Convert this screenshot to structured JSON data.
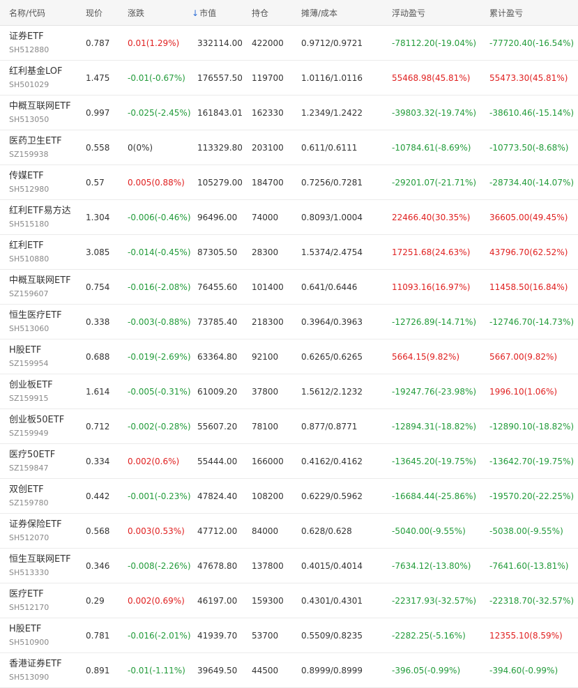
{
  "headers": {
    "name": "名称/代码",
    "price": "现价",
    "change": "涨跌",
    "market_value": "市值",
    "position": "持仓",
    "cost": "摊薄/成本",
    "float_pl": "浮动盈亏",
    "total_pl": "累计盈亏"
  },
  "sort": {
    "column": "market_value",
    "direction": "desc",
    "icon": "arrow-down-icon"
  },
  "colors": {
    "up": "#e02020",
    "down": "#229b3a",
    "flat": "#333333",
    "sort": "#2f6fd6"
  },
  "rows": [
    {
      "name": "证券ETF",
      "code": "SH512880",
      "price": "0.787",
      "change": "0.01(1.29%)",
      "change_dir": "up",
      "market_value": "332114.00",
      "position": "422000",
      "cost": "0.9712/0.9721",
      "float_pl": "-78112.20(-19.04%)",
      "float_dir": "down",
      "total_pl": "-77720.40(-16.54%)",
      "total_dir": "down"
    },
    {
      "name": "红利基金LOF",
      "code": "SH501029",
      "price": "1.475",
      "change": "-0.01(-0.67%)",
      "change_dir": "down",
      "market_value": "176557.50",
      "position": "119700",
      "cost": "1.0116/1.0116",
      "float_pl": "55468.98(45.81%)",
      "float_dir": "up",
      "total_pl": "55473.30(45.81%)",
      "total_dir": "up"
    },
    {
      "name": "中概互联网ETF",
      "code": "SH513050",
      "price": "0.997",
      "change": "-0.025(-2.45%)",
      "change_dir": "down",
      "market_value": "161843.01",
      "position": "162330",
      "cost": "1.2349/1.2422",
      "float_pl": "-39803.32(-19.74%)",
      "float_dir": "down",
      "total_pl": "-38610.46(-15.14%)",
      "total_dir": "down"
    },
    {
      "name": "医药卫生ETF",
      "code": "SZ159938",
      "price": "0.558",
      "change": "0(0%)",
      "change_dir": "flat",
      "market_value": "113329.80",
      "position": "203100",
      "cost": "0.611/0.6111",
      "float_pl": "-10784.61(-8.69%)",
      "float_dir": "down",
      "total_pl": "-10773.50(-8.68%)",
      "total_dir": "down"
    },
    {
      "name": "传媒ETF",
      "code": "SH512980",
      "price": "0.57",
      "change": "0.005(0.88%)",
      "change_dir": "up",
      "market_value": "105279.00",
      "position": "184700",
      "cost": "0.7256/0.7281",
      "float_pl": "-29201.07(-21.71%)",
      "float_dir": "down",
      "total_pl": "-28734.40(-14.07%)",
      "total_dir": "down"
    },
    {
      "name": "红利ETF易方达",
      "code": "SH515180",
      "price": "1.304",
      "change": "-0.006(-0.46%)",
      "change_dir": "down",
      "market_value": "96496.00",
      "position": "74000",
      "cost": "0.8093/1.0004",
      "float_pl": "22466.40(30.35%)",
      "float_dir": "up",
      "total_pl": "36605.00(49.45%)",
      "total_dir": "up"
    },
    {
      "name": "红利ETF",
      "code": "SH510880",
      "price": "3.085",
      "change": "-0.014(-0.45%)",
      "change_dir": "down",
      "market_value": "87305.50",
      "position": "28300",
      "cost": "1.5374/2.4754",
      "float_pl": "17251.68(24.63%)",
      "float_dir": "up",
      "total_pl": "43796.70(62.52%)",
      "total_dir": "up"
    },
    {
      "name": "中概互联网ETF",
      "code": "SZ159607",
      "price": "0.754",
      "change": "-0.016(-2.08%)",
      "change_dir": "down",
      "market_value": "76455.60",
      "position": "101400",
      "cost": "0.641/0.6446",
      "float_pl": "11093.16(16.97%)",
      "float_dir": "up",
      "total_pl": "11458.50(16.84%)",
      "total_dir": "up"
    },
    {
      "name": "恒生医疗ETF",
      "code": "SH513060",
      "price": "0.338",
      "change": "-0.003(-0.88%)",
      "change_dir": "down",
      "market_value": "73785.40",
      "position": "218300",
      "cost": "0.3964/0.3963",
      "float_pl": "-12726.89(-14.71%)",
      "float_dir": "down",
      "total_pl": "-12746.70(-14.73%)",
      "total_dir": "down"
    },
    {
      "name": "H股ETF",
      "code": "SZ159954",
      "price": "0.688",
      "change": "-0.019(-2.69%)",
      "change_dir": "down",
      "market_value": "63364.80",
      "position": "92100",
      "cost": "0.6265/0.6265",
      "float_pl": "5664.15(9.82%)",
      "float_dir": "up",
      "total_pl": "5667.00(9.82%)",
      "total_dir": "up"
    },
    {
      "name": "创业板ETF",
      "code": "SZ159915",
      "price": "1.614",
      "change": "-0.005(-0.31%)",
      "change_dir": "down",
      "market_value": "61009.20",
      "position": "37800",
      "cost": "1.5612/2.1232",
      "float_pl": "-19247.76(-23.98%)",
      "float_dir": "down",
      "total_pl": "1996.10(1.06%)",
      "total_dir": "up"
    },
    {
      "name": "创业板50ETF",
      "code": "SZ159949",
      "price": "0.712",
      "change": "-0.002(-0.28%)",
      "change_dir": "down",
      "market_value": "55607.20",
      "position": "78100",
      "cost": "0.877/0.8771",
      "float_pl": "-12894.31(-18.82%)",
      "float_dir": "down",
      "total_pl": "-12890.10(-18.82%)",
      "total_dir": "down"
    },
    {
      "name": "医疗50ETF",
      "code": "SZ159847",
      "price": "0.334",
      "change": "0.002(0.6%)",
      "change_dir": "up",
      "market_value": "55444.00",
      "position": "166000",
      "cost": "0.4162/0.4162",
      "float_pl": "-13645.20(-19.75%)",
      "float_dir": "down",
      "total_pl": "-13642.70(-19.75%)",
      "total_dir": "down"
    },
    {
      "name": "双创ETF",
      "code": "SZ159780",
      "price": "0.442",
      "change": "-0.001(-0.23%)",
      "change_dir": "down",
      "market_value": "47824.40",
      "position": "108200",
      "cost": "0.6229/0.5962",
      "float_pl": "-16684.44(-25.86%)",
      "float_dir": "down",
      "total_pl": "-19570.20(-22.25%)",
      "total_dir": "down"
    },
    {
      "name": "证券保险ETF",
      "code": "SH512070",
      "price": "0.568",
      "change": "0.003(0.53%)",
      "change_dir": "up",
      "market_value": "47712.00",
      "position": "84000",
      "cost": "0.628/0.628",
      "float_pl": "-5040.00(-9.55%)",
      "float_dir": "down",
      "total_pl": "-5038.00(-9.55%)",
      "total_dir": "down"
    },
    {
      "name": "恒生互联网ETF",
      "code": "SH513330",
      "price": "0.346",
      "change": "-0.008(-2.26%)",
      "change_dir": "down",
      "market_value": "47678.80",
      "position": "137800",
      "cost": "0.4015/0.4014",
      "float_pl": "-7634.12(-13.80%)",
      "float_dir": "down",
      "total_pl": "-7641.60(-13.81%)",
      "total_dir": "down"
    },
    {
      "name": "医疗ETF",
      "code": "SH512170",
      "price": "0.29",
      "change": "0.002(0.69%)",
      "change_dir": "up",
      "market_value": "46197.00",
      "position": "159300",
      "cost": "0.4301/0.4301",
      "float_pl": "-22317.93(-32.57%)",
      "float_dir": "down",
      "total_pl": "-22318.70(-32.57%)",
      "total_dir": "down"
    },
    {
      "name": "H股ETF",
      "code": "SH510900",
      "price": "0.781",
      "change": "-0.016(-2.01%)",
      "change_dir": "down",
      "market_value": "41939.70",
      "position": "53700",
      "cost": "0.5509/0.8235",
      "float_pl": "-2282.25(-5.16%)",
      "float_dir": "down",
      "total_pl": "12355.10(8.59%)",
      "total_dir": "up"
    },
    {
      "name": "香港证券ETF",
      "code": "SH513090",
      "price": "0.891",
      "change": "-0.01(-1.11%)",
      "change_dir": "down",
      "market_value": "39649.50",
      "position": "44500",
      "cost": "0.8999/0.8999",
      "float_pl": "-396.05(-0.99%)",
      "float_dir": "down",
      "total_pl": "-394.60(-0.99%)",
      "total_dir": "down"
    }
  ]
}
